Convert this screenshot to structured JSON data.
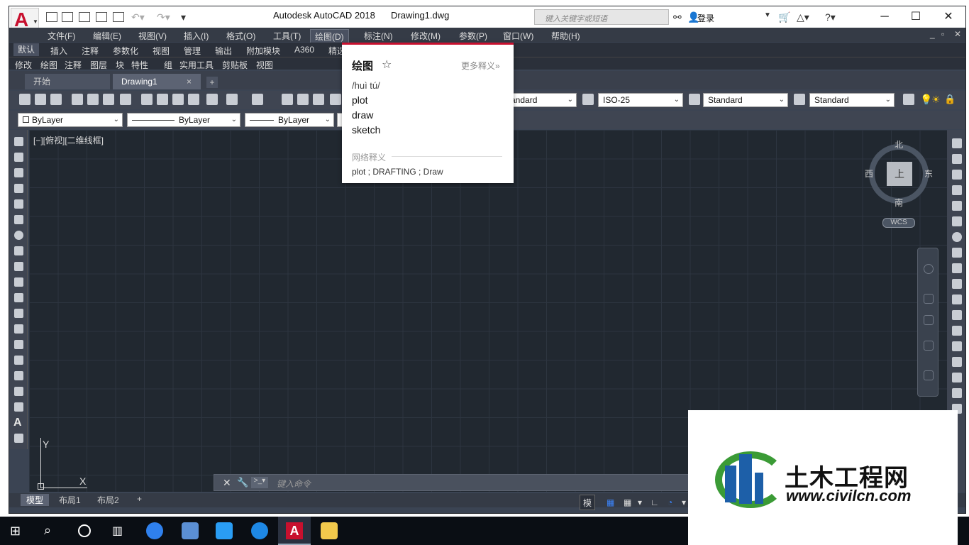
{
  "titlebar": {
    "app_title": "Autodesk AutoCAD 2018",
    "file_title": "Drawing1.dwg",
    "search_placeholder": "键入关键字或短语",
    "login_label": "登录",
    "logo_letter": "A"
  },
  "menubar": [
    "文件(F)",
    "编辑(E)",
    "视图(V)",
    "插入(I)",
    "格式(O)",
    "工具(T)",
    "绘图(D)",
    "标注(N)",
    "修改(M)",
    "参数(P)",
    "窗口(W)",
    "帮助(H)"
  ],
  "ribbon_tabs": [
    "默认",
    "插入",
    "注释",
    "参数化",
    "视图",
    "管理",
    "输出",
    "附加模块",
    "A360",
    "精选"
  ],
  "panel_bar": [
    "修改",
    "绘图",
    "注释",
    "图层",
    "块",
    "特性",
    "组",
    "实用工具",
    "剪贴板",
    "视图"
  ],
  "file_tabs": {
    "start": "开始",
    "drawing": "Drawing1"
  },
  "toolbar1": {
    "dimstyle_partial": "andard",
    "dimscale": "ISO-25",
    "tablestyle": "Standard",
    "mleaderstyle": "Standard"
  },
  "toolbar2": {
    "color": "ByLayer",
    "linetype": "ByLayer",
    "lineweight": "ByLayer"
  },
  "view_label": "[−][俯视][二维线框]",
  "viewcube": {
    "north": "北",
    "south": "南",
    "east": "东",
    "west": "西",
    "top": "上",
    "wcs": "WCS"
  },
  "ucs": {
    "x": "X",
    "y": "Y"
  },
  "command_line": {
    "placeholder": "键入命令"
  },
  "layout_tabs": [
    "模型",
    "布局1",
    "布局2"
  ],
  "status": {
    "model": "模型"
  },
  "dictionary": {
    "word": "绘图",
    "more": "更多释义»",
    "pronunciation": "/huì tú/",
    "definitions": [
      "plot",
      "draw",
      "sketch"
    ],
    "web_section": "网络释义",
    "web_definitions": "plot ; DRAFTING ; Draw"
  },
  "watermark": {
    "brand": "土木工程网",
    "url": "www.civilcn.com"
  },
  "colors": {
    "accent": "#c8102e",
    "canvas": "#212830",
    "ui_dark": "#3b4453"
  }
}
